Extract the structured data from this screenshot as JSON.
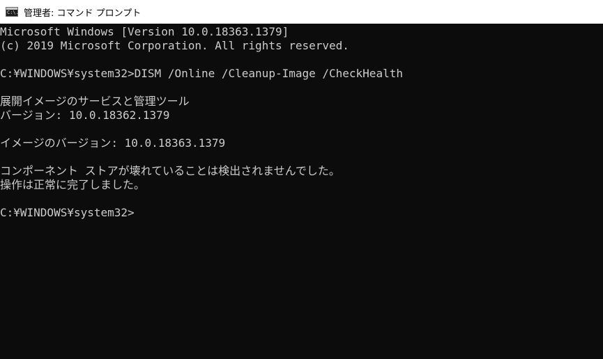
{
  "window": {
    "title": "管理者: コマンド プロンプト",
    "icon": "command-prompt-icon",
    "icon_text": "C:\\."
  },
  "console": {
    "lines": [
      "Microsoft Windows [Version 10.0.18363.1379]",
      "(c) 2019 Microsoft Corporation. All rights reserved.",
      "",
      "C:¥WINDOWS¥system32>DISM /Online /Cleanup-Image /CheckHealth",
      "",
      "展開イメージのサービスと管理ツール",
      "バージョン: 10.0.18362.1379",
      "",
      "イメージのバージョン: 10.0.18363.1379",
      "",
      "コンポーネント ストアが壊れていることは検出されませんでした。",
      "操作は正常に完了しました。",
      "",
      "C:¥WINDOWS¥system32>"
    ]
  },
  "colors": {
    "background": "#0c0c0c",
    "foreground": "#cccccc",
    "titlebar": "#ffffff"
  }
}
